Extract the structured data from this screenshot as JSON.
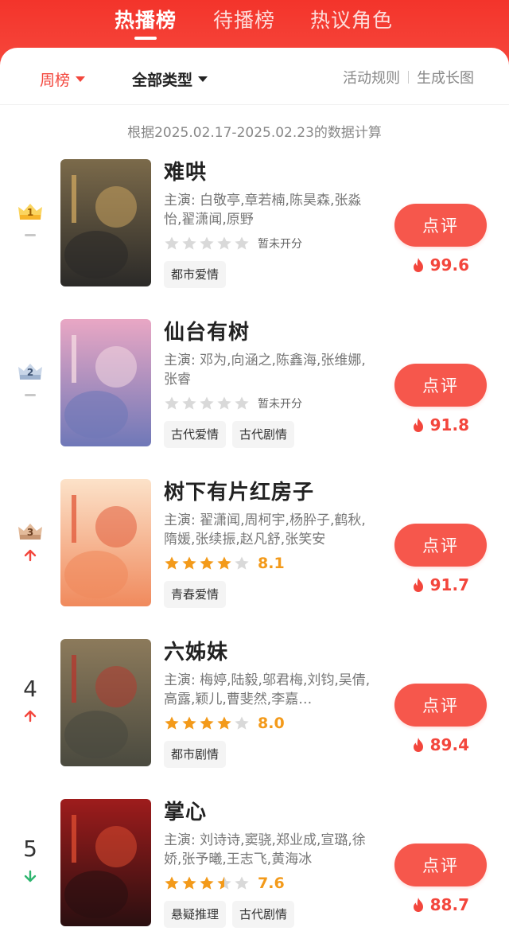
{
  "top_tabs": [
    {
      "label": "热播榜",
      "active": true
    },
    {
      "label": "待播榜",
      "active": false
    },
    {
      "label": "热议角色",
      "active": false
    }
  ],
  "filters": {
    "period": "周榜",
    "type": "全部类型",
    "rules_link": "活动规则",
    "long_image_link": "生成长图"
  },
  "basis_text": "根据2025.02.17-2025.02.23的数据计算",
  "review_label": "点评",
  "no_score_text": "暂未开分",
  "items": [
    {
      "rank": "1",
      "rank_style": "crown-gold",
      "trend": "flat",
      "title": "难哄",
      "cast": "主演: 白敬亭,章若楠,陈昊森,张淼怡,翟潇闻,原野",
      "stars": 0,
      "score": "",
      "tags": [
        "都市爱情"
      ],
      "heat": "99.6",
      "poster_colors": [
        "#2b2a28",
        "#7b6a4a",
        "#c9a25e"
      ]
    },
    {
      "rank": "2",
      "rank_style": "crown-silver",
      "trend": "flat",
      "title": "仙台有树",
      "cast": "主演: 邓为,向涵之,陈鑫海,张维娜,张睿",
      "stars": 0,
      "score": "",
      "tags": [
        "古代爱情",
        "古代剧情"
      ],
      "heat": "91.8",
      "poster_colors": [
        "#6f78b8",
        "#e9a7c4",
        "#f2d7e0"
      ]
    },
    {
      "rank": "3",
      "rank_style": "crown-bronze",
      "trend": "up",
      "title": "树下有片红房子",
      "cast": "主演: 翟潇闻,周柯宇,杨肸子,鹤秋,隋媛,张续振,赵凡舒,张笑安",
      "stars": 4,
      "score": "8.1",
      "tags": [
        "青春爱情"
      ],
      "heat": "91.7",
      "poster_colors": [
        "#f08a5d",
        "#fce2c9",
        "#e25e3e"
      ]
    },
    {
      "rank": "4",
      "rank_style": "number",
      "trend": "up",
      "title": "六姊妹",
      "cast": "主演: 梅婷,陆毅,邬君梅,刘钧,吴倩,高露,颖儿,曹斐然,李嘉…",
      "stars": 4,
      "score": "8.0",
      "tags": [
        "都市剧情"
      ],
      "heat": "89.4",
      "poster_colors": [
        "#4a4a3f",
        "#8c7a5b",
        "#b33a2f"
      ]
    },
    {
      "rank": "5",
      "rank_style": "number",
      "trend": "down",
      "title": "掌心",
      "cast": "主演: 刘诗诗,窦骁,郑业成,宣璐,徐娇,张予曦,王志飞,黄海冰",
      "stars": 3.5,
      "score": "7.6",
      "tags": [
        "悬疑推理",
        "古代剧情"
      ],
      "heat": "88.7",
      "poster_colors": [
        "#2a0f10",
        "#9e1c1c",
        "#d94b2f"
      ]
    }
  ],
  "colors": {
    "brand_red": "#f3463c",
    "button_red": "#f6574c",
    "star_gold": "#f39a1a",
    "trend_up": "#f3463c",
    "trend_down": "#2db56e"
  }
}
